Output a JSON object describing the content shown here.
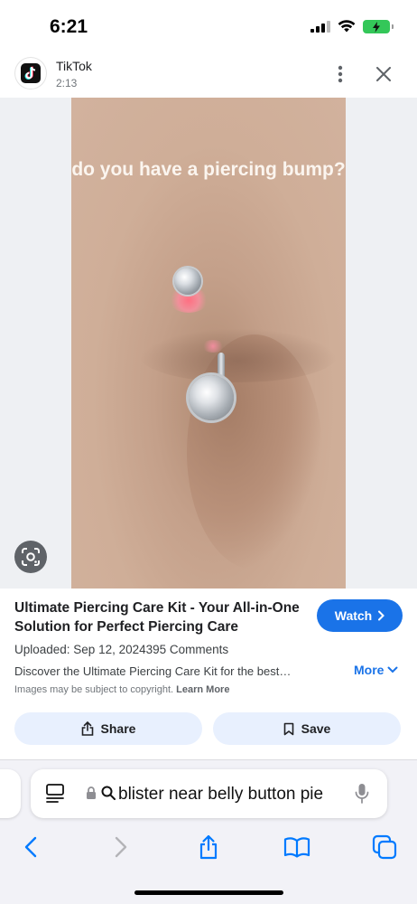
{
  "status": {
    "time": "6:21",
    "battery_color": "#34c759"
  },
  "header": {
    "app_name": "TikTok",
    "duration": "2:13",
    "app_icon": "tiktok-logo-icon",
    "menu_icon": "more-vertical-icon",
    "close_icon": "close-icon"
  },
  "media": {
    "caption": "do you have a piercing bump?",
    "lens_icon": "google-lens-icon"
  },
  "info": {
    "title": "Ultimate Piercing Care Kit - Your All-in-One Solution for Perfect Piercing Care",
    "watch_label": "Watch",
    "uploaded": "Uploaded: Sep 12, 2024395 Comments",
    "description": "Discover the Ultimate Piercing Care Kit for the best…",
    "more_label": "More",
    "copyright_text": "Images may be subject to copyright.",
    "learn_more": "Learn More",
    "share_label": "Share",
    "save_label": "Save",
    "accent_color": "#1a73e8",
    "pill_color": "#e8f0fe"
  },
  "browser": {
    "address_text": "blister near belly button pie",
    "toolbar_icons": [
      "back-icon",
      "forward-icon",
      "share-icon",
      "bookmarks-icon",
      "tabs-icon"
    ]
  }
}
